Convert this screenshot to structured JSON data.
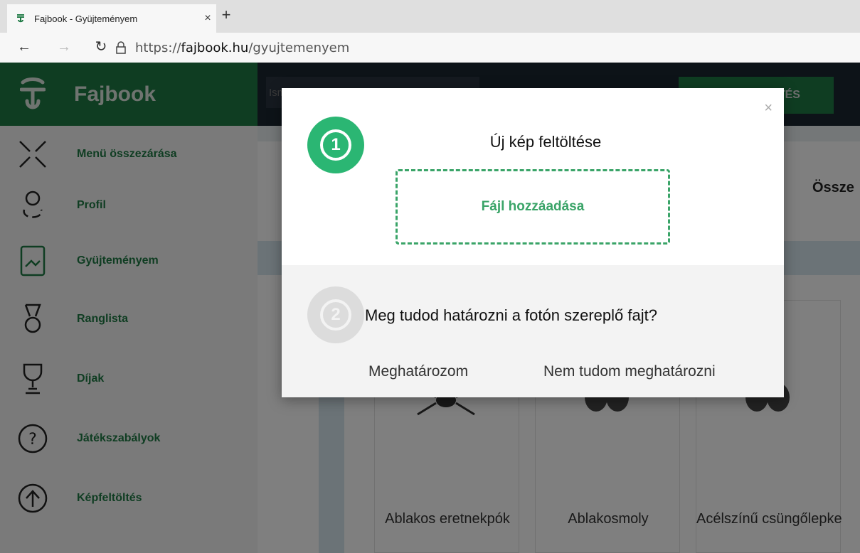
{
  "browser": {
    "tab_title": "Fajbook - Gyüjteményem",
    "tab_close": "×",
    "new_tab": "+",
    "url_prefix": "https://",
    "url_domain": "fajbook.hu",
    "url_path": "/gyujtemenyem",
    "back": "←",
    "forward": "→",
    "reload": "↻"
  },
  "app": {
    "brand_name": "Fajbook",
    "search_placeholder": "Ismeretlen fajok keresése",
    "upload_cta": "KÉPFELTÖLTÉS",
    "brand_color": "#1f7a45",
    "sidebar": [
      {
        "label": "Menü összezárása",
        "icon": "close-menu-icon"
      },
      {
        "label": "Profil",
        "icon": "profile-icon"
      },
      {
        "label": "Gyüjteményem",
        "icon": "gallery-icon"
      },
      {
        "label": "Ranglista",
        "icon": "medal-icon"
      },
      {
        "label": "Díjak",
        "icon": "trophy-icon"
      },
      {
        "label": "Játékszabályok",
        "icon": "help-icon"
      },
      {
        "label": "Képfeltöltés",
        "icon": "upload-icon"
      }
    ],
    "content_title": "Össze",
    "cards": [
      {
        "name": "Ablakos eretnekpók"
      },
      {
        "name": "Ablakosmoly"
      },
      {
        "name": "Acélszínű csüngőlepke"
      }
    ]
  },
  "modal": {
    "close": "×",
    "step1_number": "1",
    "step1_title": "Új kép feltöltése",
    "dropzone_label": "Fájl hozzáadása",
    "step2_number": "2",
    "step2_question": "Meg tudod határozni a fotón szereplő fajt?",
    "option_yes": "Meghatározom",
    "option_no": "Nem tudom meghatározni",
    "accent_color": "#2bb673"
  }
}
